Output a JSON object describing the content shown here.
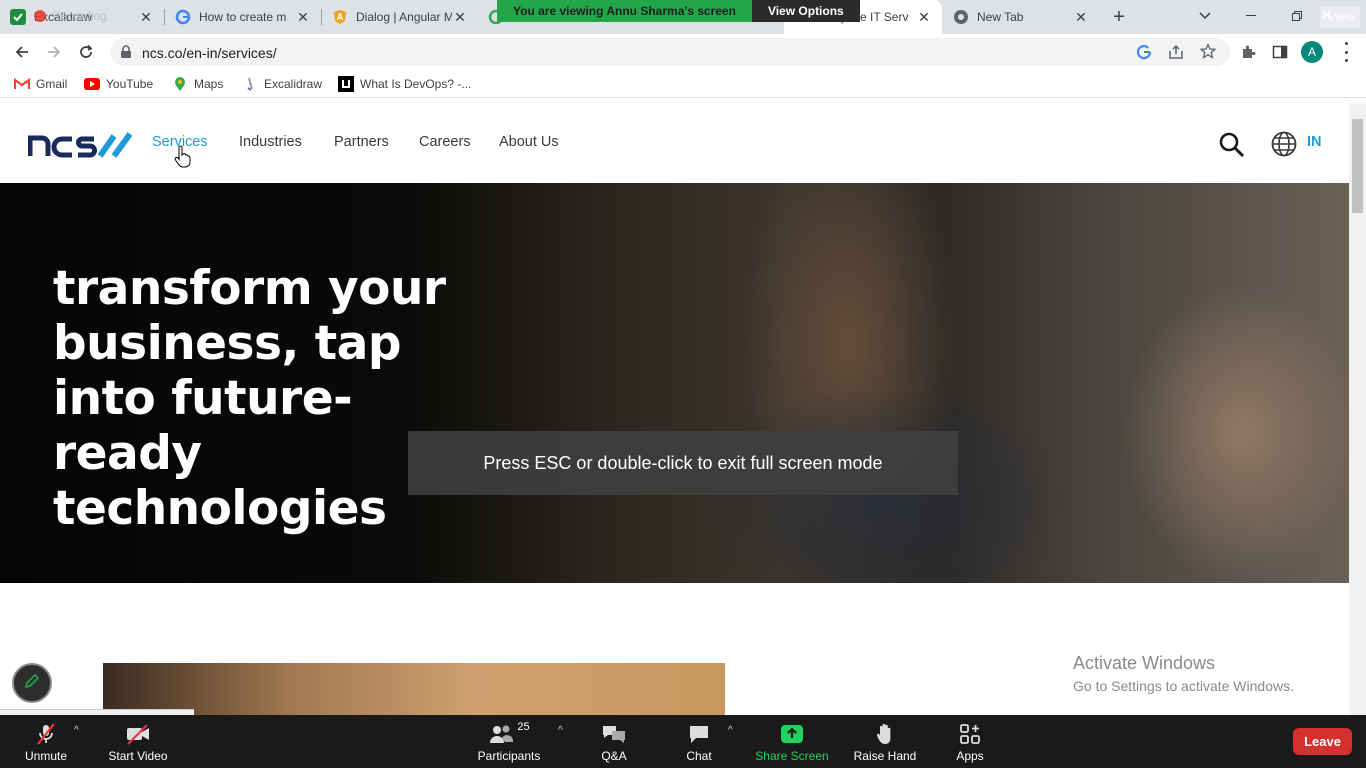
{
  "browser": {
    "tabs": [
      {
        "title": "Excalidraw",
        "overlay": "Recording"
      },
      {
        "title": "How to create m"
      },
      {
        "title": "Dialog | Angular M"
      },
      {
        "title": "Enterprise IT Serv"
      },
      {
        "title": "New Tab"
      }
    ],
    "url": "ncs.co/en-in/services/",
    "profile_initial": "A",
    "bookmarks": [
      "Gmail",
      "YouTube",
      "Maps",
      "Excalidraw",
      "What Is DevOps? -..."
    ]
  },
  "zoom_banner": {
    "viewing_text": "You are viewing Annu Sharma's screen",
    "view_options": "View Options",
    "view_button": "View"
  },
  "site": {
    "nav": [
      "Services",
      "Industries",
      "Partners",
      "Careers",
      "About Us"
    ],
    "region": "IN",
    "hero_title": "transform your business, tap into future-ready technologies",
    "brand_color": "#1f9bd8"
  },
  "overlay": {
    "esc_message": "Press ESC or double-click to exit full screen mode"
  },
  "windows_watermark": {
    "title": "Activate Windows",
    "subtitle": "Go to Settings to activate Windows."
  },
  "zoom_controls": {
    "unmute": "Unmute",
    "start_video": "Start Video",
    "participants": "Participants",
    "participant_count": "25",
    "qa": "Q&A",
    "chat": "Chat",
    "share_screen": "Share Screen",
    "raise_hand": "Raise Hand",
    "apps": "Apps",
    "leave": "Leave"
  }
}
